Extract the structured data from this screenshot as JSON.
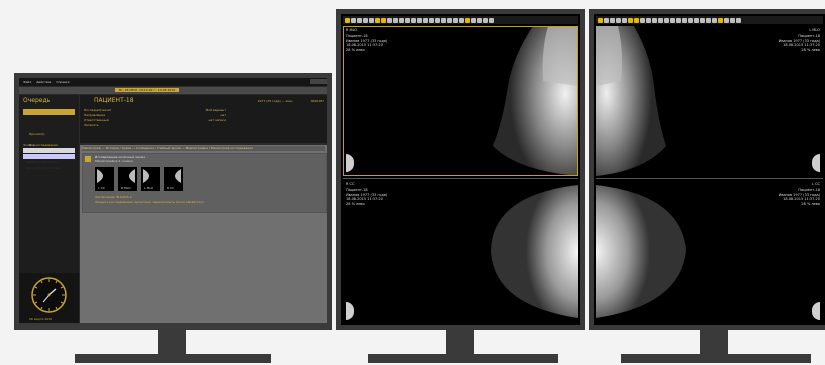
{
  "left_app": {
    "menu": [
      "Файл",
      "Действия",
      "Справка"
    ],
    "status_bar": "Вс, 28 ИЮЛ. 18:14:02 г., 10:08 2019",
    "section_title": "Очередь",
    "patient_name": "ПАЦИЕНТ-18",
    "patient_meta": "1977 (33 года) — жен.",
    "patient_id": "0000187",
    "sidebar_items": [
      "Сегодня",
      "Просмотр",
      "Все исследования"
    ],
    "sidebar_group": "Фильтр",
    "sidebar_filters": [
      "Требуют обработки",
      "Просмотр обработано"
    ],
    "info_rows": [
      {
        "label": "Последний визит",
        "value": "Мой вариант"
      },
      {
        "label": "Направление",
        "value": "нет"
      },
      {
        "label": "Ответственный",
        "value": "нет записи"
      },
      {
        "label": "Записать",
        "value": ""
      }
    ],
    "breadcrumbs": "Маммограф — История / Архив — Сообщения / Учебный архив — Маммография / Маммограф-исследования",
    "study_title": "Исследование молочных желез",
    "study_subtitle": "Маммография 4 снимка",
    "thumbs": [
      "L CC",
      "R MLO",
      "L MLO",
      "R CC"
    ],
    "study_note": "Заключение: BI-RADS 2",
    "study_note2": "Закрыть (исследование прочитано, пересмотреть после обработки)",
    "clock_date": "28 марта 2019"
  },
  "viewer_middle": {
    "top": {
      "side_label": "R MLO",
      "info": [
        "Пациент-18",
        "Иванов 1977 (33 года)",
        "18.08.2015 11:37:20",
        "28 % лево"
      ]
    },
    "bottom": {
      "side_label": "R CC",
      "info": [
        "Пациент-18",
        "Иванов 1977 (33 года)",
        "18.08.2015 11:37:20",
        "28 % лево"
      ]
    }
  },
  "viewer_right": {
    "top": {
      "side_label": "L MLO",
      "info": [
        "Пациент-18",
        "Иванов 1977 (33 года)",
        "18.08.2015 11:37:20",
        "28 % лево"
      ]
    },
    "bottom": {
      "side_label": "L CC",
      "info": [
        "Пациент-18",
        "Иванов 1977 (33 года)",
        "18.08.2015 11:37:20",
        "28 % лево"
      ]
    }
  },
  "colors": {
    "accent": "#d9b540",
    "frame": "#3a3a3a",
    "selection": "#c9a200"
  },
  "icons": {
    "toolbar": "viewer-tools",
    "clock": "analog-clock-icon"
  }
}
